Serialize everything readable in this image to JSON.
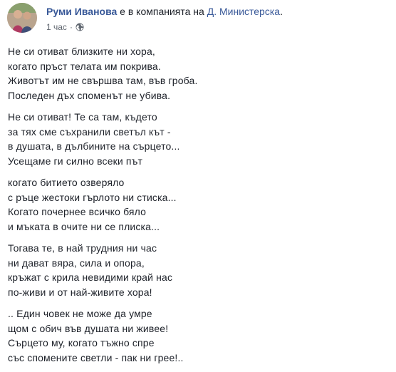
{
  "post": {
    "author": "Руми Иванова",
    "with_text": "е в компанията на",
    "tagged": "Д. Министерска",
    "tagged_suffix": ".",
    "time": "1 час",
    "separator": "·",
    "privacy_icon": "globe-icon"
  },
  "poem": {
    "stanzas": [
      [
        "Не си отиват близките ни хора,",
        "когато пръст телата им покрива.",
        "Животът им не свършва там, във гроба.",
        "Последен дъх споменът не убива."
      ],
      [
        "Не си отиват! Те са там, където",
        "за тях сме съхранили светъл кът -",
        "в душата, в дълбините на сърцето...",
        "Усещаме ги силно всеки път"
      ],
      [
        "когато битието озверяло",
        "с ръце жестоки гърлото ни стиска...",
        "Когато почернее всичко бяло",
        "и мъката в очите ни се плиска..."
      ],
      [
        "Тогава те, в най трудния ни час",
        "ни дават вяра, сила и опора,",
        "кръжат с крила невидими край нас",
        "по-живи и от най-живите хора!"
      ],
      [
        ".. Един човек не може да умре",
        "щом с обич във душата ни живее!",
        "Сърцето му, когато тъжно спре",
        "със спомените светли - пак ни грее!.."
      ]
    ]
  }
}
